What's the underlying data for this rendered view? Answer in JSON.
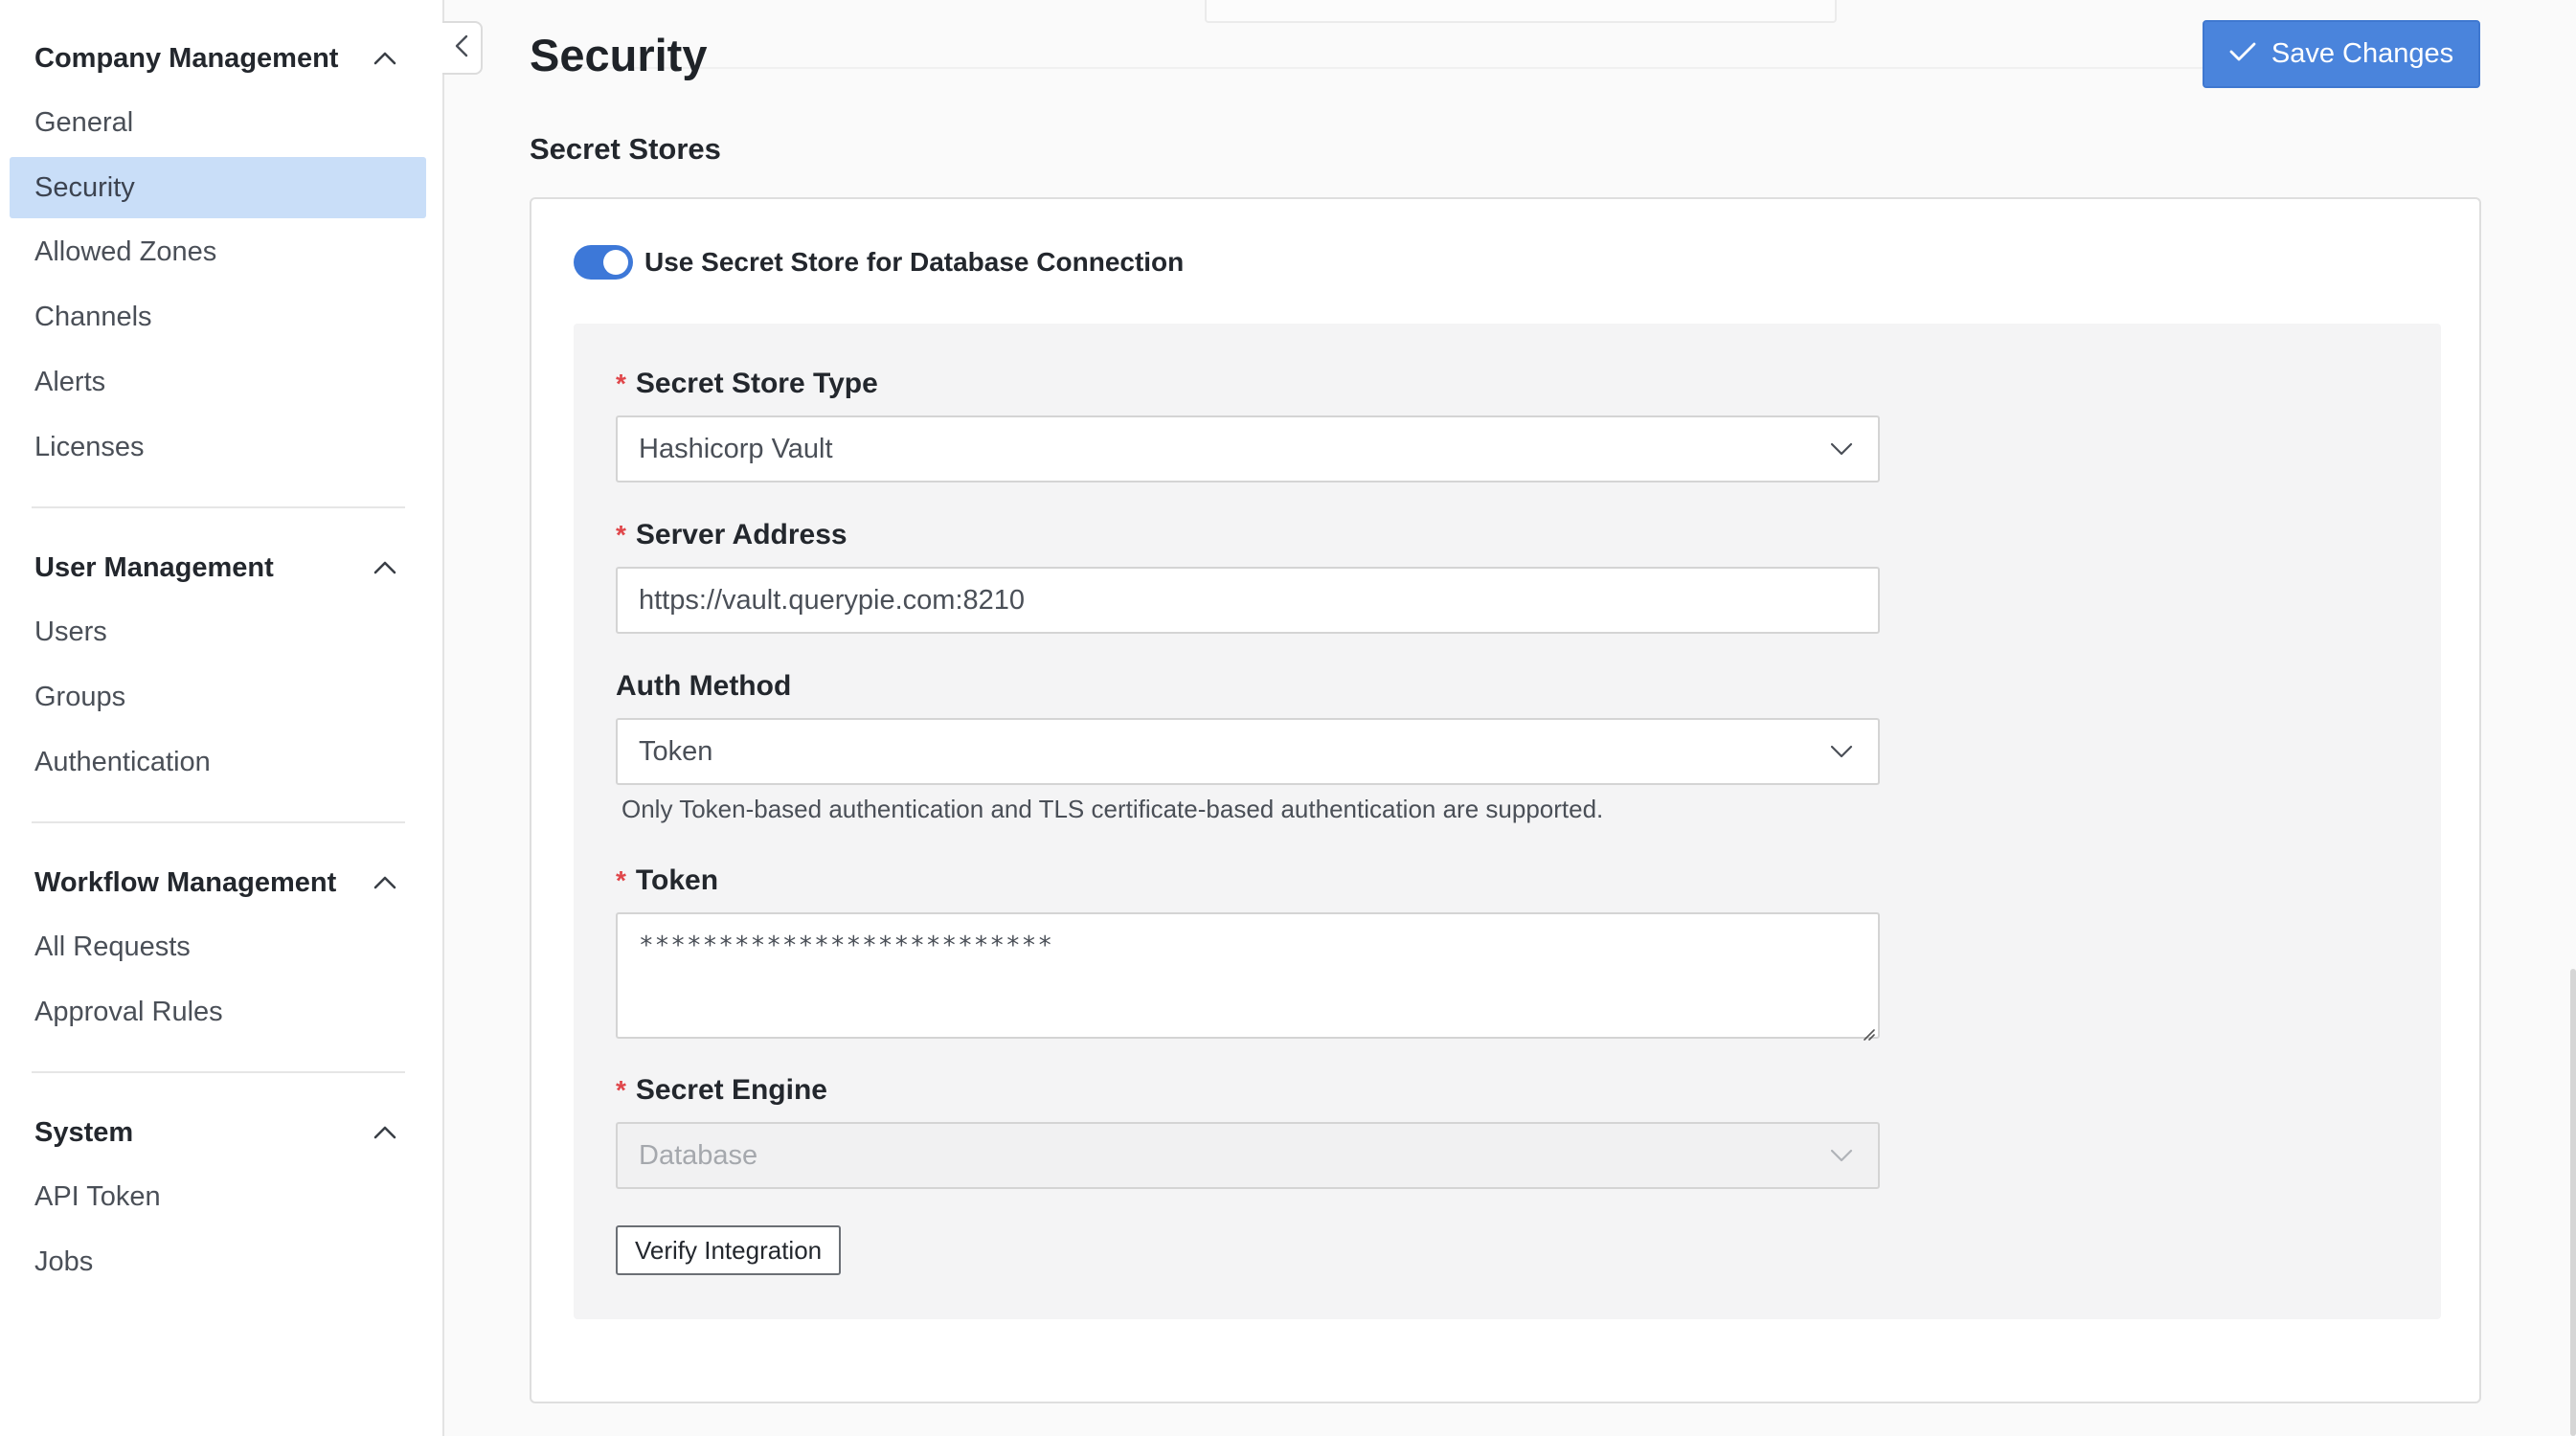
{
  "sidebar": {
    "sections": [
      {
        "title": "Company Management",
        "items": [
          "General",
          "Security",
          "Allowed Zones",
          "Channels",
          "Alerts",
          "Licenses"
        ]
      },
      {
        "title": "User Management",
        "items": [
          "Users",
          "Groups",
          "Authentication"
        ]
      },
      {
        "title": "Workflow Management",
        "items": [
          "All Requests",
          "Approval Rules"
        ]
      },
      {
        "title": "System",
        "items": [
          "API Token",
          "Jobs"
        ]
      }
    ],
    "active_item": "Security"
  },
  "header": {
    "title": "Security",
    "save_label": "Save Changes"
  },
  "secret_stores": {
    "title": "Secret Stores",
    "toggle_label": "Use Secret Store for Database Connection",
    "toggle_on": true,
    "store_type": {
      "label": "Secret Store Type",
      "value": "Hashicorp Vault"
    },
    "server_address": {
      "label": "Server Address",
      "value": "https://vault.querypie.com:8210"
    },
    "auth_method": {
      "label": "Auth Method",
      "value": "Token",
      "hint": "Only Token-based authentication and TLS certificate-based authentication are supported."
    },
    "token": {
      "label": "Token",
      "value": "**************************"
    },
    "secret_engine": {
      "label": "Secret Engine",
      "placeholder": "Database"
    },
    "verify_label": "Verify Integration"
  },
  "colors": {
    "accent": "#4a84dc",
    "active_nav_bg": "#c9def8",
    "required": "#e0464a"
  },
  "icons": {
    "save": "check-icon",
    "section_toggle": "chevron-up-icon",
    "collapse": "chevron-left-icon",
    "select": "chevron-down-icon"
  }
}
